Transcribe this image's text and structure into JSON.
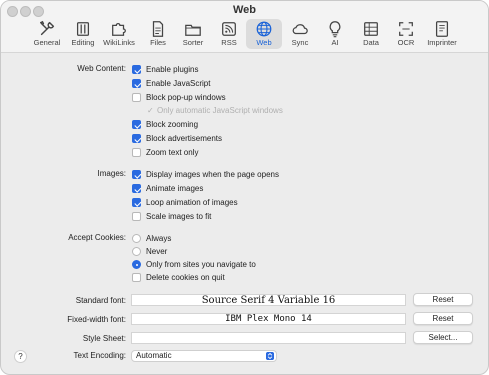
{
  "window": {
    "title": "Web"
  },
  "toolbar": [
    {
      "name": "general",
      "label": "General",
      "icon": "tools-icon"
    },
    {
      "name": "editing",
      "label": "Editing",
      "icon": "pencil-icon"
    },
    {
      "name": "wikilinks",
      "label": "WikiLinks",
      "icon": "puzzle-icon"
    },
    {
      "name": "files",
      "label": "Files",
      "icon": "document-icon"
    },
    {
      "name": "sorter",
      "label": "Sorter",
      "icon": "folder-icon"
    },
    {
      "name": "rss",
      "label": "RSS",
      "icon": "rss-icon"
    },
    {
      "name": "web",
      "label": "Web",
      "icon": "globe-icon",
      "active": true
    },
    {
      "name": "sync",
      "label": "Sync",
      "icon": "cloud-icon"
    },
    {
      "name": "ai",
      "label": "AI",
      "icon": "lightbulb-icon"
    },
    {
      "name": "data",
      "label": "Data",
      "icon": "table-icon"
    },
    {
      "name": "ocr",
      "label": "OCR",
      "icon": "scan-icon"
    },
    {
      "name": "imprinter",
      "label": "Imprinter",
      "icon": "imprinter-icon"
    }
  ],
  "web_content": {
    "label": "Web Content:",
    "options": [
      {
        "label": "Enable plugins",
        "checked": true
      },
      {
        "label": "Enable JavaScript",
        "checked": true
      },
      {
        "label": "Block pop-up windows",
        "checked": false
      },
      {
        "label": "Only automatic JavaScript windows",
        "checked": true,
        "disabled": true
      },
      {
        "label": "Block zooming",
        "checked": true
      },
      {
        "label": "Block advertisements",
        "checked": true
      },
      {
        "label": "Zoom text only",
        "checked": false
      }
    ]
  },
  "images": {
    "label": "Images:",
    "options": [
      {
        "label": "Display images when the page opens",
        "checked": true
      },
      {
        "label": "Animate images",
        "checked": true
      },
      {
        "label": "Loop animation of images",
        "checked": true
      },
      {
        "label": "Scale images to fit",
        "checked": false
      }
    ]
  },
  "cookies": {
    "label": "Accept Cookies:",
    "options": [
      {
        "label": "Always",
        "selected": false
      },
      {
        "label": "Never",
        "selected": false
      },
      {
        "label": "Only from sites you navigate to",
        "selected": true
      }
    ],
    "delete_on_quit": {
      "label": "Delete cookies on quit",
      "checked": false
    }
  },
  "fonts": {
    "standard_label": "Standard font:",
    "standard_value": "Source Serif 4 Variable 16",
    "fixed_label": "Fixed-width font:",
    "fixed_value": "IBM Plex Mono 14",
    "reset_label": "Reset"
  },
  "style_sheet": {
    "label": "Style Sheet:",
    "value": "",
    "select_label": "Select..."
  },
  "encoding": {
    "label": "Text Encoding:",
    "value": "Automatic"
  },
  "help": {
    "label": "?"
  },
  "colors": {
    "accent": "#2a6ae0"
  }
}
